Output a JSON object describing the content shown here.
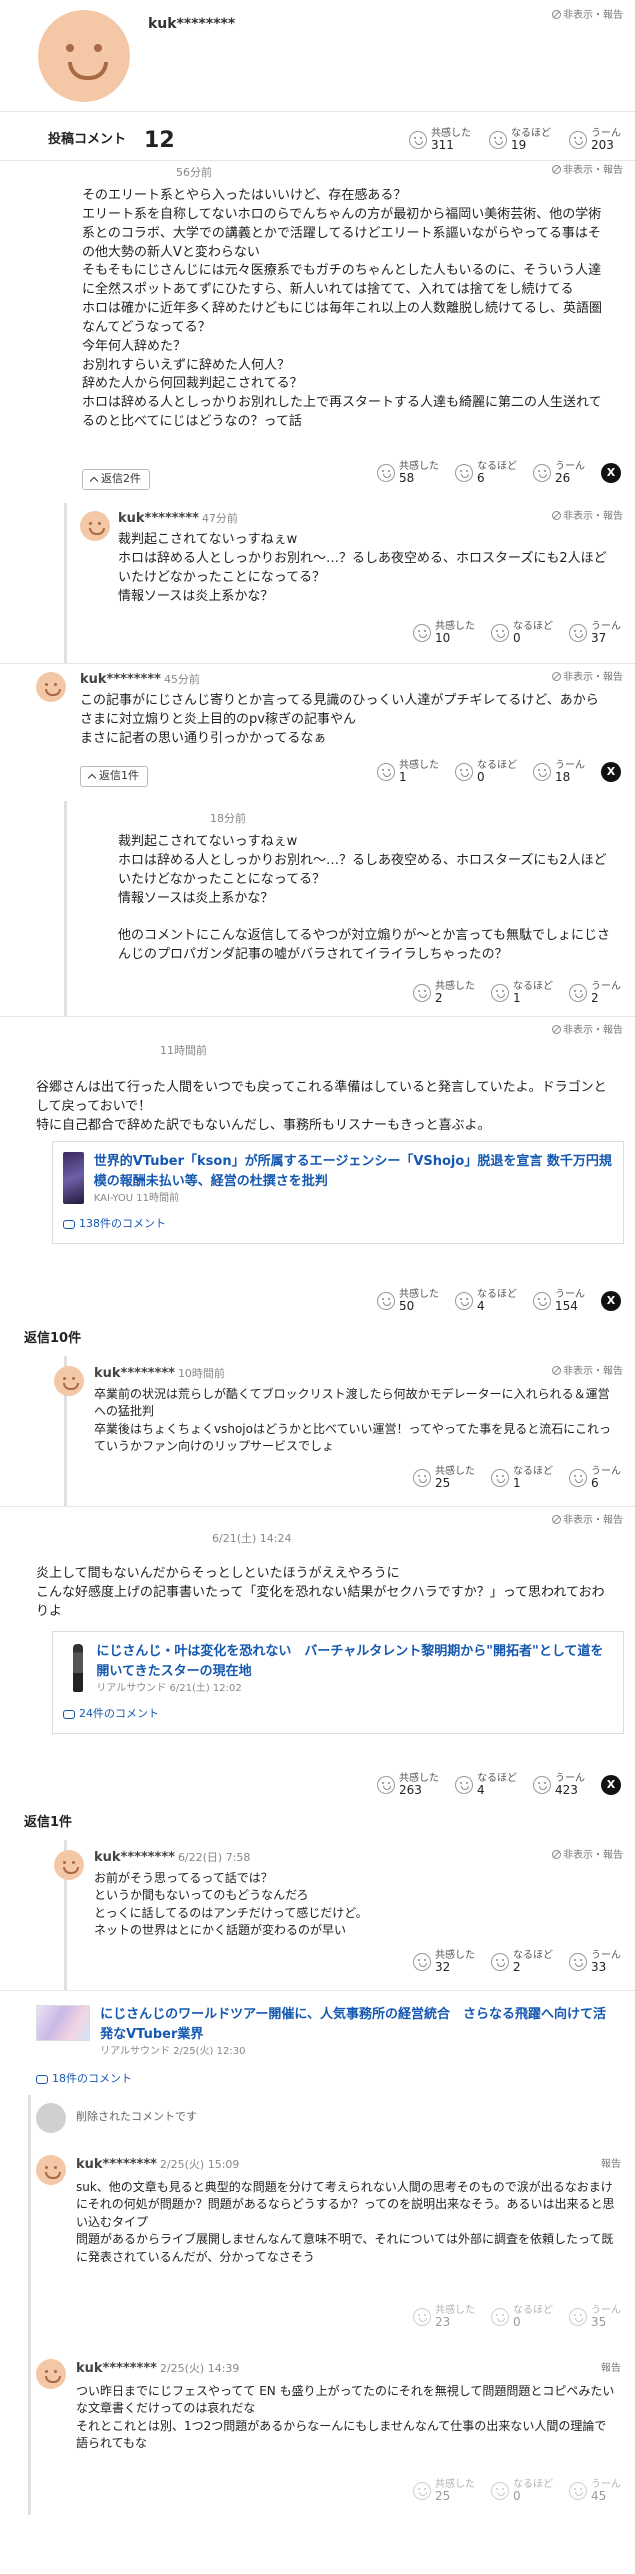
{
  "profile": {
    "name": "kuk********",
    "report": "非表示・報告"
  },
  "summary": {
    "label": "投稿コメント",
    "count": "12"
  },
  "labels": {
    "kyokan": "共感した",
    "naruhodo": "なるほど",
    "uun": "うーん",
    "report": "非表示・報告",
    "report_short": "報告",
    "x": "X"
  },
  "summary_reactions": {
    "kyokan": "311",
    "naruhodo": "19",
    "uun": "203"
  },
  "c1": {
    "time": "56分前",
    "text": "そのエリート系とやら入ったはいいけど、存在感ある？\nエリート系を自称してないホロのらでんちゃんの方が最初から福岡い美術芸術、他の学術系とのコラボ、大学での講義とかで活躍してるけどエリート系謳いながらやってる事はその他大勢の新人Vと変わらない\nそもそもにじさんじには元々医療系でもガチのちゃんとした人もいるのに、そういう人達に全然スポットあてずにひたすら、新人いれては捨てて、入れては捨てをし続けてる\nホロは確かに近年多く辞めたけどもにじは毎年これ以上の人数離脱し続けてるし、英語圏なんてどうなってる？\n今年何人辞めた？\nお別れすらいえずに辞めた人何人？\n辞めた人から何回裁判起こされてる？\nホロは辞める人としっかりお別れした上で再スタートする人達も綺麗に第二の人生送れてるのと比べてにじはどうなの？って話",
    "reply_btn": "返信2件",
    "reactions": {
      "kyokan": "58",
      "naruhodo": "6",
      "uun": "26"
    }
  },
  "r1": {
    "name": "kuk********",
    "time": "47分前",
    "text": "裁判起こされてないっすねぇw\nホロは辞める人としっかりお別れ～…？るしあ夜空める、ホロスターズにも2人ほどいたけどなかったことになってる？\n情報ソースは炎上系かな？",
    "reactions": {
      "kyokan": "10",
      "naruhodo": "0",
      "uun": "37"
    }
  },
  "c2": {
    "name": "kuk********",
    "time": "45分前",
    "text": "この記事がにじさんじ寄りとか言ってる見識のひっくい人達がプチギレてるけど、あからさまに対立煽りと炎上目的のpv稼ぎの記事やん\nまさに記者の思い通り引っかかってるなぁ",
    "reply_btn": "返信1件",
    "reactions": {
      "kyokan": "1",
      "naruhodo": "0",
      "uun": "18"
    }
  },
  "r2": {
    "time": "18分前",
    "text": "裁判起こされてないっすねぇw\nホロは辞める人としっかりお別れ～…？るしあ夜空める、ホロスターズにも2人ほどいたけどなかったことになってる？\n情報ソースは炎上系かな？\n\n他のコメントにこんな返信してるやつが対立煽りが～とか言っても無駄でしょにじさんじのプロパガンダ記事の嘘がバラされてイライラしちゃったの？",
    "reactions": {
      "kyokan": "2",
      "naruhodo": "1",
      "uun": "2"
    }
  },
  "c3": {
    "time": "11時間前",
    "text": "谷郷さんは出て行った人間をいつでも戻ってこれる準備はしていると発言していたよ。ドラゴンとして戻っておいで！\n特に自己都合で辞めた訳でもないんだし、事務所もリスナーもきっと喜ぶよ。",
    "article": {
      "title": "世界的VTuber「kson」が所属するエージェンシー「VShojo」脱退を宣言 数千万円規模の報酬未払い等、経営の杜撰さを批判",
      "source": "KAI-YOU 11時間前",
      "comments": "138件のコメント"
    },
    "reactions": {
      "kyokan": "50",
      "naruhodo": "4",
      "uun": "154"
    },
    "replies_label": "返信10件"
  },
  "r3": {
    "name": "kuk********",
    "time": "10時間前",
    "text": "卒業前の状況は荒らしが酷くてブロックリスト渡したら何故かモデレーターに入れられる＆運営への猛批判\n卒業後はちょくちょくvshojoはどうかと比べていい運営！ってやってた事を見ると流石にこれっていうかファン向けのリップサービスでしょ",
    "reactions": {
      "kyokan": "25",
      "naruhodo": "1",
      "uun": "6"
    }
  },
  "c4": {
    "time": "6/21(土) 14:24",
    "text": "炎上して間もないんだからそっとしといたほうがええやろうに\nこんな好感度上げの記事書いたって「変化を恐れない結果がセクハラですか？」って思われておわりよ",
    "article": {
      "title": "にじさんじ・叶は変化を恐れない　バーチャルタレント黎明期から\"開拓者\"として道を開いてきたスターの現在地",
      "source": "リアルサウンド 6/21(土) 12:02",
      "comments": "24件のコメント"
    },
    "reactions": {
      "kyokan": "263",
      "naruhodo": "4",
      "uun": "423"
    },
    "replies_label": "返信1件"
  },
  "r4": {
    "name": "kuk********",
    "time": "6/22(日) 7:58",
    "text": "お前がそう思ってるって話では？\nというか間もないってのもどうなんだろ\nとっくに話してるのはアンチだけって感じだけど。\nネットの世界はとにかく話題が変わるのが早い",
    "reactions": {
      "kyokan": "32",
      "naruhodo": "2",
      "uun": "33"
    }
  },
  "c5": {
    "article": {
      "title": "にじさんじのワールドツアー開催に、人気事務所の経営統合　さらなる飛躍へ向けて活発なVTuber業界",
      "source": "リアルサウンド 2/25(火) 12:30",
      "comments": "18件のコメント"
    },
    "deleted": "削除されたコメントです",
    "r1": {
      "name": "kuk********",
      "time": "2/25(火) 15:09",
      "text": "suk、他の文章も見ると典型的な問題を分けて考えられない人間の思考そのもので涙が出るなおまけにそれの何処が問題か？問題があるならどうするか？ってのを説明出来なそう。あるいは出来ると思い込むタイプ\n問題があるからライブ展開しませんなんて意味不明で、それについては外部に調査を依頼したって既に発表されているんだが、分かってなさそう",
      "reactions": {
        "kyokan": "23",
        "naruhodo": "0",
        "uun": "35"
      }
    },
    "r2": {
      "name": "kuk********",
      "time": "2/25(火) 14:39",
      "text": "つい昨日までにじフェスやってて EN も盛り上がってたのにそれを無視して問題問題とコピペみたいな文章書くだけってのは哀れだな\nそれとこれとは別、1つ2つ問題があるからなーんにもしませんなんて仕事の出来ない人間の理論で語られてもな",
      "reactions": {
        "kyokan": "25",
        "naruhodo": "0",
        "uun": "45"
      }
    }
  }
}
